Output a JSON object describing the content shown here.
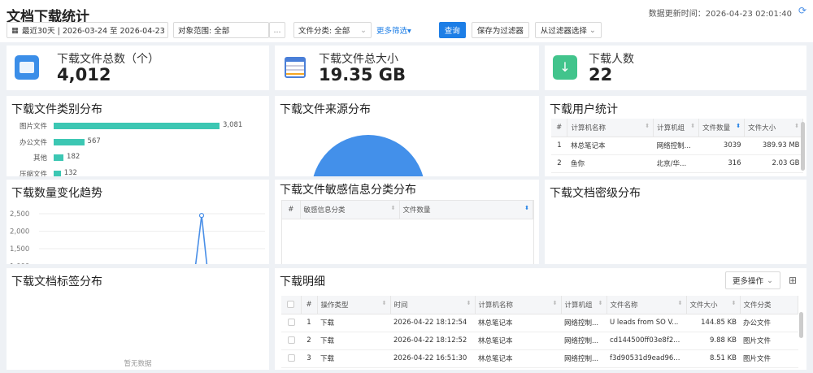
{
  "header": {
    "title": "文档下载统计",
    "updated_label": "数据更新时间：",
    "updated_value": "2026-04-23 02:01:40"
  },
  "filters": {
    "date_range": "最近30天 | 2026-03-24 至 2026-04-23",
    "scope_label": "对象范围: 全部",
    "scope_more": "...",
    "category": "文件分类: 全部",
    "more_filter": "更多筛选",
    "query_button": "查询",
    "save_filter_button": "保存为过滤器",
    "from_filter_select": "从过滤器选择"
  },
  "kpis": [
    {
      "label": "下载文件总数（个）",
      "value": "4,012"
    },
    {
      "label": "下载文件总大小",
      "value": "19.35 GB"
    },
    {
      "label": "下载人数",
      "value": "22"
    }
  ],
  "panels": {
    "file_category": "下载文件类别分布",
    "file_source": "下载文件来源分布",
    "user_stats": "下载用户统计",
    "trend": "下载数量变化趋势",
    "sensitive": "下载文件敏感信息分类分布",
    "security_level": "下载文档密级分布",
    "tags": "下载文档标签分布",
    "details": "下载明细"
  },
  "chart_data": [
    {
      "type": "bar",
      "title": "下载文件类别分布",
      "categories": [
        "图片文件",
        "办公文件",
        "其他",
        "压缩文件"
      ],
      "values": [
        3081,
        567,
        182,
        132
      ]
    },
    {
      "type": "line",
      "title": "下载数量变化趋势",
      "y_ticks": [
        "2,500",
        "2,000",
        "1,500",
        "1,000"
      ],
      "peak": 2450
    }
  ],
  "user_table": {
    "headers": [
      "#",
      "计算机名称",
      "计算机组",
      "文件数量",
      "文件大小"
    ],
    "rows": [
      [
        "1",
        "林总笔记本",
        "网络控制...",
        "3039",
        "389.93 MB"
      ],
      [
        "2",
        "鱼你",
        "北京/华...",
        "316",
        "2.03 GB"
      ]
    ]
  },
  "sensitive_table": {
    "headers": [
      "#",
      "敏感信息分类",
      "文件数量"
    ]
  },
  "tags_empty": "暂无数据",
  "details": {
    "more_actions": "更多操作",
    "headers": [
      "#",
      "操作类型",
      "时间",
      "计算机名称",
      "计算机组",
      "文件名称",
      "文件大小",
      "文件分类"
    ],
    "rows": [
      [
        "1",
        "下载",
        "2026-04-22 18:12:54",
        "林总笔记本",
        "网络控制...",
        "U leads from SO V...",
        "144.85 KB",
        "办公文件"
      ],
      [
        "2",
        "下载",
        "2026-04-22 18:12:52",
        "林总笔记本",
        "网络控制...",
        "cd144500ff03e8f2...",
        "9.88 KB",
        "图片文件"
      ],
      [
        "3",
        "下载",
        "2026-04-22 16:51:30",
        "林总笔记本",
        "网络控制...",
        "f3d90531d9ead96...",
        "8.51 KB",
        "图片文件"
      ]
    ]
  }
}
